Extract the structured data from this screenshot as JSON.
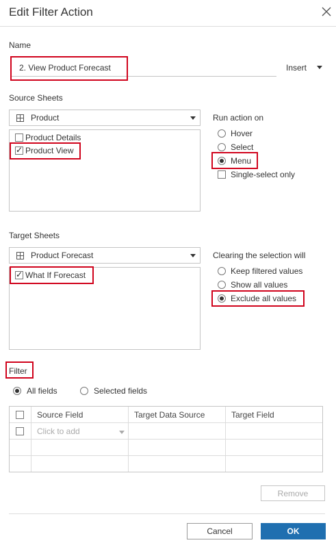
{
  "dialog": {
    "title": "Edit Filter Action"
  },
  "name_section": {
    "label": "Name",
    "value": "2. View Product Forecast",
    "insert_label": "Insert"
  },
  "source": {
    "label": "Source Sheets",
    "selected_datasource": "Product",
    "sheets": [
      {
        "label": "Product Details",
        "checked": false
      },
      {
        "label": "Product View",
        "checked": true
      }
    ]
  },
  "run_action": {
    "label": "Run action on",
    "options": [
      {
        "label": "Hover",
        "selected": false
      },
      {
        "label": "Select",
        "selected": false
      },
      {
        "label": "Menu",
        "selected": true
      }
    ],
    "single_select_label": "Single-select only"
  },
  "target": {
    "label": "Target Sheets",
    "selected_dashboard": "Product Forecast",
    "sheets": [
      {
        "label": "What If Forecast",
        "checked": true
      }
    ]
  },
  "clearing": {
    "label": "Clearing the selection will",
    "options": [
      {
        "label": "Keep filtered values",
        "selected": false
      },
      {
        "label": "Show all values",
        "selected": false
      },
      {
        "label": "Exclude all values",
        "selected": true
      }
    ]
  },
  "filter": {
    "label": "Filter",
    "all_fields_label": "All fields",
    "selected_fields_label": "Selected fields",
    "columns": [
      "Source Field",
      "Target Data Source",
      "Target Field"
    ],
    "add_placeholder": "Click to add"
  },
  "buttons": {
    "remove": "Remove",
    "cancel": "Cancel",
    "ok": "OK"
  },
  "colors": {
    "highlight": "#d0021b",
    "primary": "#1f6fb0"
  },
  "icons": [
    "close-icon",
    "caret-down-icon",
    "sheet-grid-icon"
  ]
}
